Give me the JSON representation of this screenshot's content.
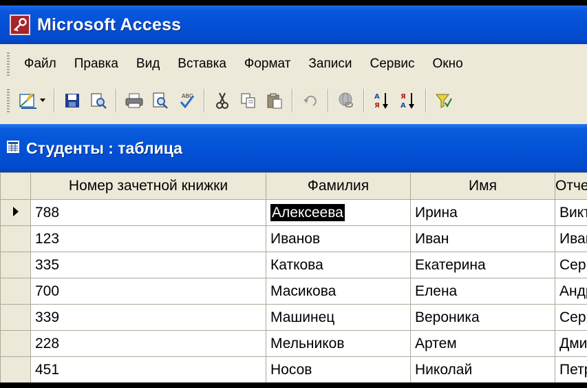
{
  "window": {
    "title": "Microsoft Access",
    "icon": "access-key-icon"
  },
  "menu": {
    "items": [
      {
        "label": "Файл"
      },
      {
        "label": "Правка"
      },
      {
        "label": "Вид"
      },
      {
        "label": "Вставка"
      },
      {
        "label": "Формат"
      },
      {
        "label": "Записи"
      },
      {
        "label": "Сервис"
      },
      {
        "label": "Окно"
      }
    ]
  },
  "toolbar": {
    "buttons": [
      "design-view-icon",
      "save-icon",
      "file-search-icon",
      "print-icon",
      "print-preview-icon",
      "spelling-icon",
      "cut-icon",
      "copy-icon",
      "paste-icon",
      "undo-icon",
      "hyperlink-icon",
      "sort-ascending-icon",
      "sort-descending-icon",
      "filter-icon"
    ]
  },
  "table_window": {
    "title": "Студенты : таблица",
    "columns": [
      "Номер зачетной книжки",
      "Фамилия",
      "Имя",
      "Отчество"
    ],
    "rows": [
      {
        "num": "788",
        "last": "Алексеева",
        "first": "Ирина",
        "mid": "Викторовна",
        "current": true,
        "selected_field": "last"
      },
      {
        "num": "123",
        "last": "Иванов",
        "first": "Иван",
        "mid": "Иванович"
      },
      {
        "num": "335",
        "last": "Каткова",
        "first": "Екатерина",
        "mid": "Сергеевна"
      },
      {
        "num": "700",
        "last": "Масикова",
        "first": "Елена",
        "mid": "Андреевна"
      },
      {
        "num": "339",
        "last": "Машинец",
        "first": "Вероника",
        "mid": "Сергеевна"
      },
      {
        "num": "228",
        "last": "Мельников",
        "first": "Артем",
        "mid": "Дмитриевич"
      },
      {
        "num": "451",
        "last": "Носов",
        "first": "Николай",
        "mid": "Петрович"
      }
    ]
  },
  "colors": {
    "title_bar": "#0350D6",
    "chrome": "#ECE9D8",
    "selection": "#000000",
    "grid_line": "#ACA899"
  }
}
